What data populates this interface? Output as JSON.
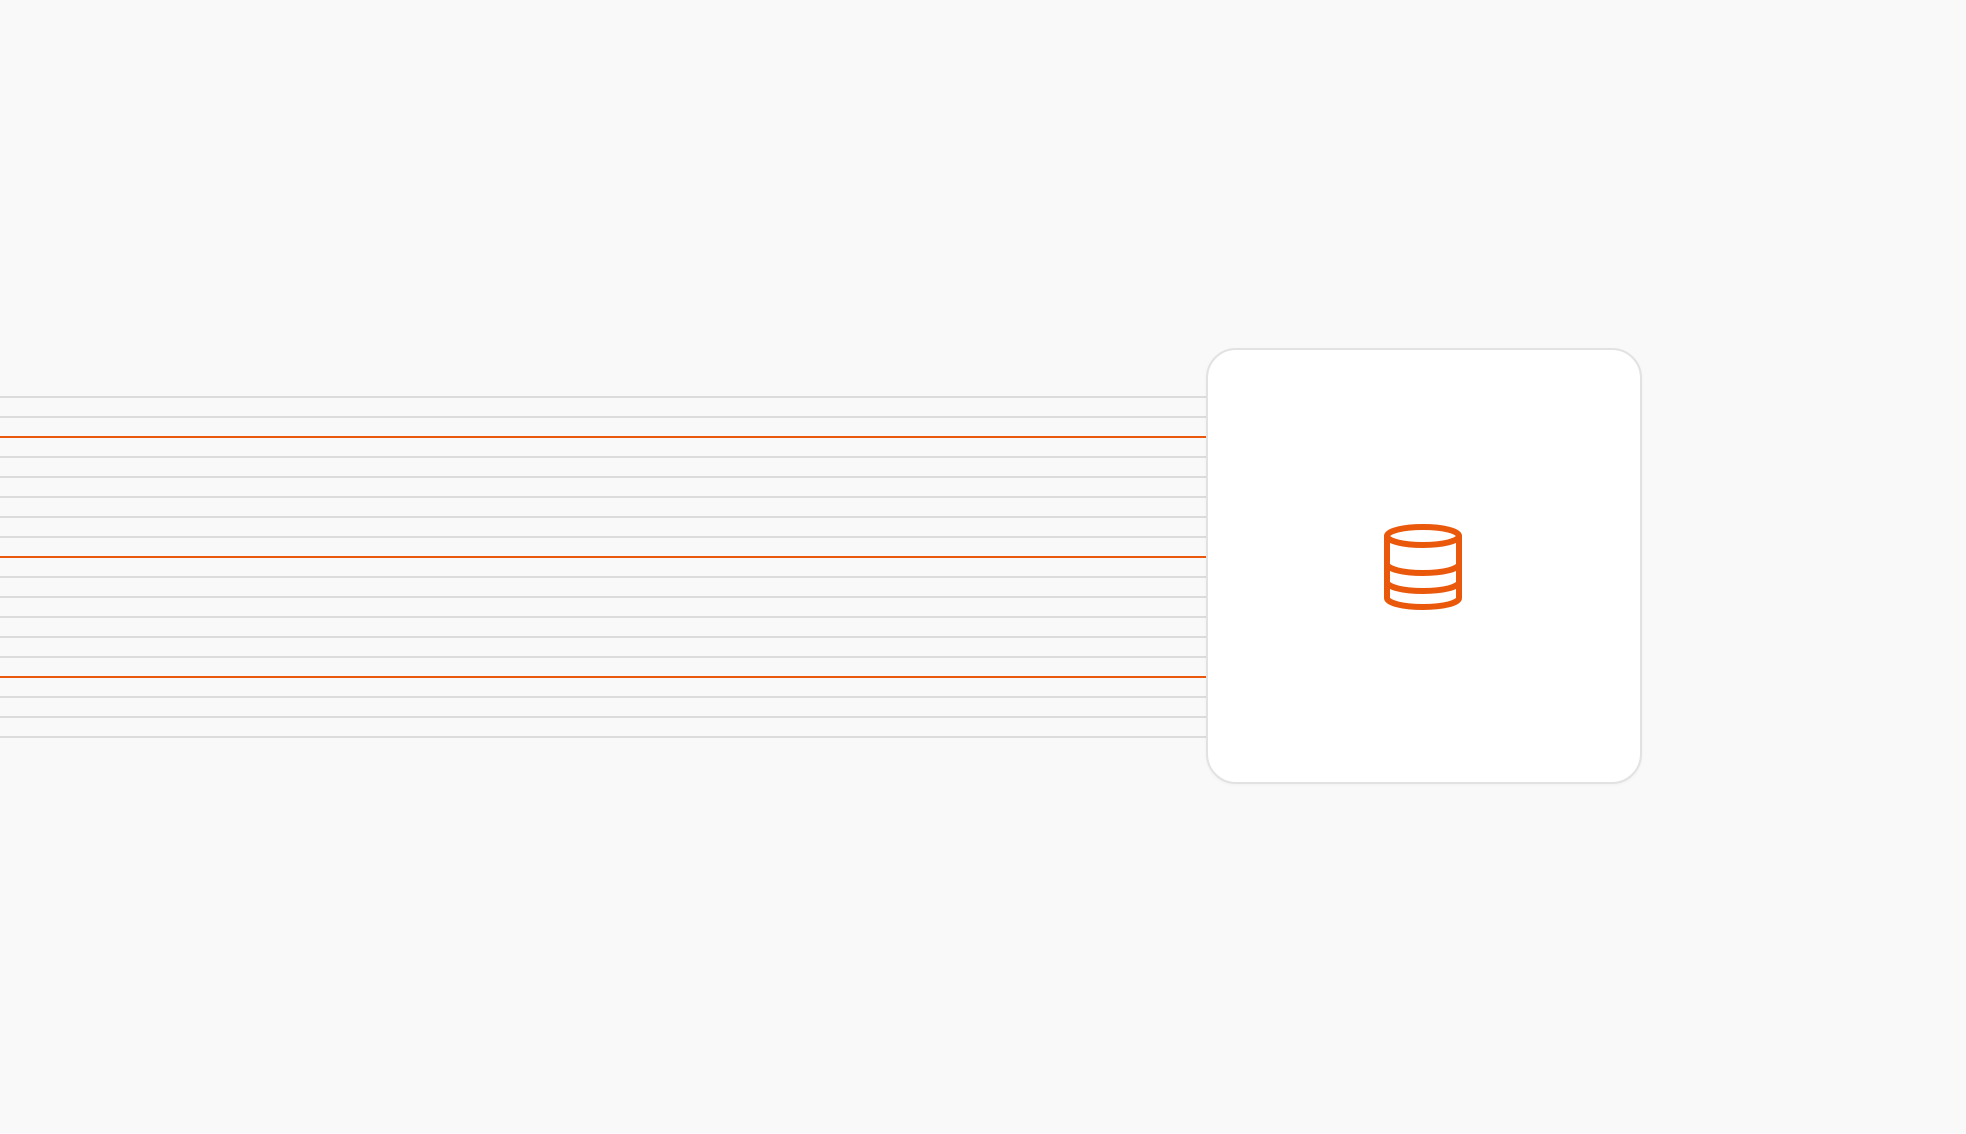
{
  "scene": {
    "colors": {
      "background": "#f9f9f9",
      "line_muted": "#dcdcdc",
      "line_accent": "#ea580c",
      "card_background": "#ffffff",
      "card_border": "#e2e2e2",
      "icon": "#ea580c"
    },
    "lines": [
      {
        "kind": "muted"
      },
      {
        "kind": "muted"
      },
      {
        "kind": "accent"
      },
      {
        "kind": "muted"
      },
      {
        "kind": "muted"
      },
      {
        "kind": "muted"
      },
      {
        "kind": "muted"
      },
      {
        "kind": "muted"
      },
      {
        "kind": "accent"
      },
      {
        "kind": "muted"
      },
      {
        "kind": "muted"
      },
      {
        "kind": "muted"
      },
      {
        "kind": "muted"
      },
      {
        "kind": "muted"
      },
      {
        "kind": "accent"
      },
      {
        "kind": "muted"
      },
      {
        "kind": "muted"
      },
      {
        "kind": "muted"
      }
    ],
    "card": {
      "icon": "database-icon"
    }
  }
}
